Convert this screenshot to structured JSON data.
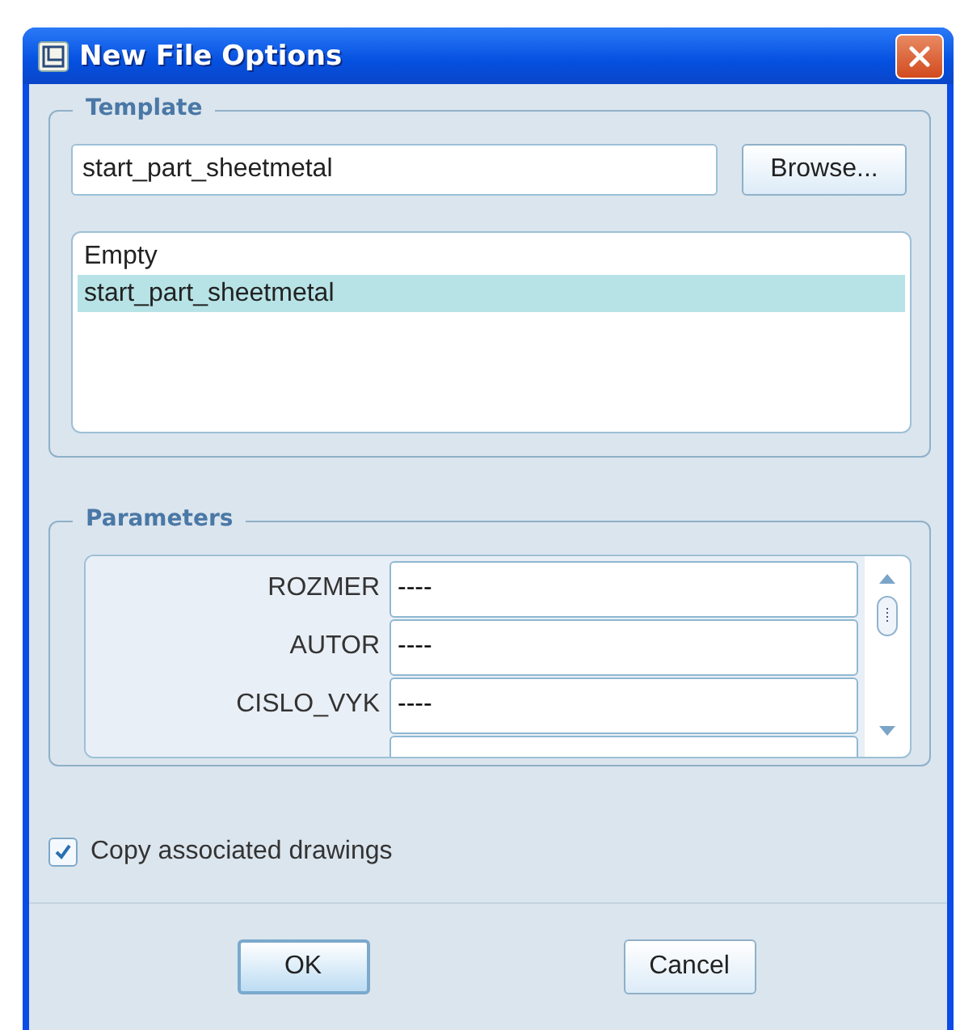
{
  "window": {
    "title": "New File Options"
  },
  "template": {
    "legend": "Template",
    "value": "start_part_sheetmetal",
    "browse_button": "Browse...",
    "items": [
      {
        "label": "Empty",
        "selected": false
      },
      {
        "label": "start_part_sheetmetal",
        "selected": true
      }
    ]
  },
  "parameters": {
    "legend": "Parameters",
    "rows": [
      {
        "name": "ROZMER",
        "value": "----"
      },
      {
        "name": "AUTOR",
        "value": "----"
      },
      {
        "name": "CISLO_VYK",
        "value": "----"
      }
    ]
  },
  "copy_drawings": {
    "label": "Copy associated drawings",
    "checked": true
  },
  "buttons": [
    {
      "label": "OK",
      "default": true
    },
    {
      "label": "Cancel",
      "default": false
    }
  ]
}
